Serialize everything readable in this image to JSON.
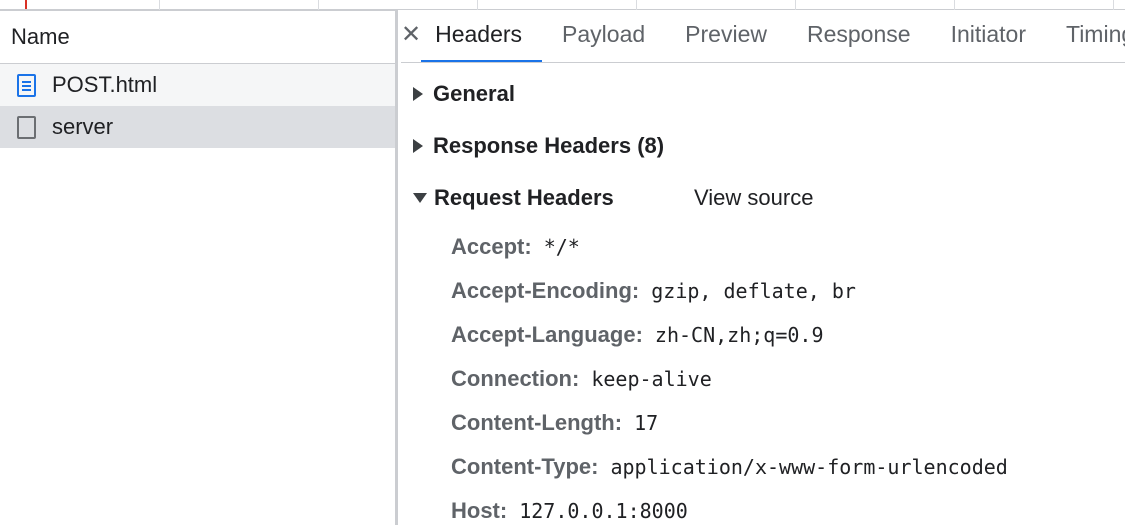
{
  "request_list": {
    "column_header": "Name",
    "rows": [
      {
        "label": "POST.html",
        "icon": "document-icon"
      },
      {
        "label": "server",
        "icon": "file-icon"
      }
    ]
  },
  "detail_tabs": {
    "close_symbol": "✕",
    "tabs": [
      "Headers",
      "Payload",
      "Preview",
      "Response",
      "Initiator",
      "Timing"
    ]
  },
  "sections": {
    "general": "General",
    "response_headers": "Response Headers (8)",
    "request_headers": "Request Headers",
    "view_source": "View source"
  },
  "request_headers": [
    {
      "name": "Accept:",
      "value": "*/*"
    },
    {
      "name": "Accept-Encoding:",
      "value": "gzip, deflate, br"
    },
    {
      "name": "Accept-Language:",
      "value": "zh-CN,zh;q=0.9"
    },
    {
      "name": "Connection:",
      "value": "keep-alive"
    },
    {
      "name": "Content-Length:",
      "value": "17"
    },
    {
      "name": "Content-Type:",
      "value": "application/x-www-form-urlencoded"
    },
    {
      "name": "Host:",
      "value": "127.0.0.1:8000"
    }
  ],
  "colors": {
    "accent": "#1a73e8",
    "selected_row": "#dcdee2",
    "header_name": "#5f6368",
    "timeline_marker": "#d93025"
  }
}
